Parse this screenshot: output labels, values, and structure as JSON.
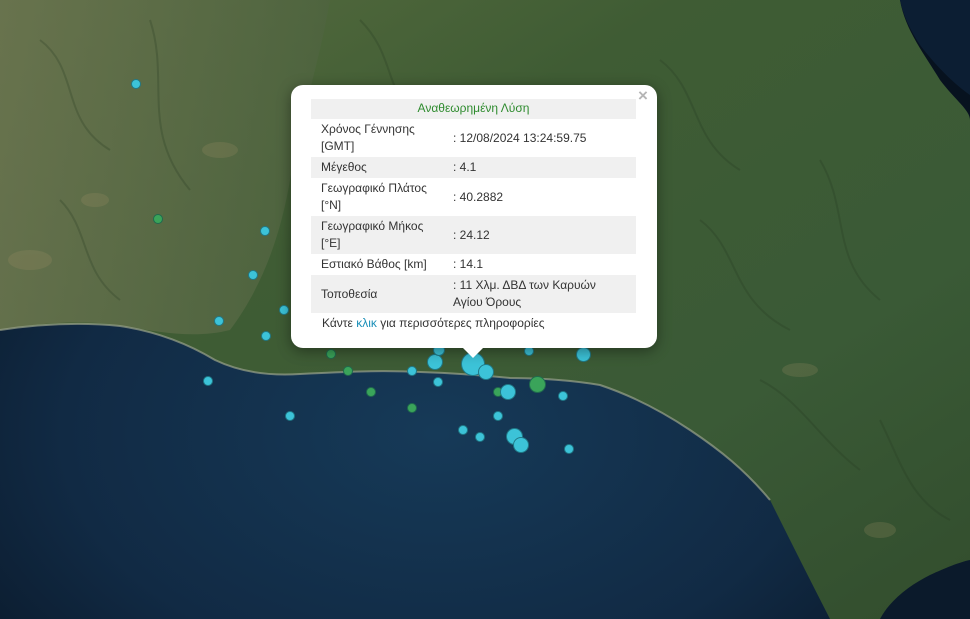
{
  "popup": {
    "title": "Αναθεωρημένη Λύση",
    "close_symbol": "×",
    "rows": [
      {
        "label": "Χρόνος Γέννησης [GMT]",
        "value": ": 12/08/2024 13:24:59.75"
      },
      {
        "label": "Μέγεθος",
        "value": ": 4.1"
      },
      {
        "label": "Γεωγραφικό Πλάτος [°N]",
        "value": ": 40.2882"
      },
      {
        "label": "Γεωγραφικό Μήκος [°E]",
        "value": ": 24.12"
      },
      {
        "label": "Εστιακό Βάθος [km]",
        "value": ": 14.1"
      },
      {
        "label": "Τοποθεσία",
        "value": ": 11 Χλμ. ΔΒΔ των Καρυών Αγίου Όρους"
      }
    ],
    "more_prefix": "Κάντε ",
    "more_link": "κλικ",
    "more_suffix": " για περισσότερες πληροφορίες"
  },
  "colors": {
    "marker_cyan": "#3cc3d8",
    "marker_green": "#3aa45a",
    "sea": "#0f2238",
    "land": "#3e5a33",
    "popup_title": "#2e8b2e",
    "link": "#1a8fb8"
  },
  "map": {
    "layer": "satellite imagery",
    "icons": [
      "earthquake-marker-cyan",
      "earthquake-marker-green",
      "close-icon"
    ]
  }
}
